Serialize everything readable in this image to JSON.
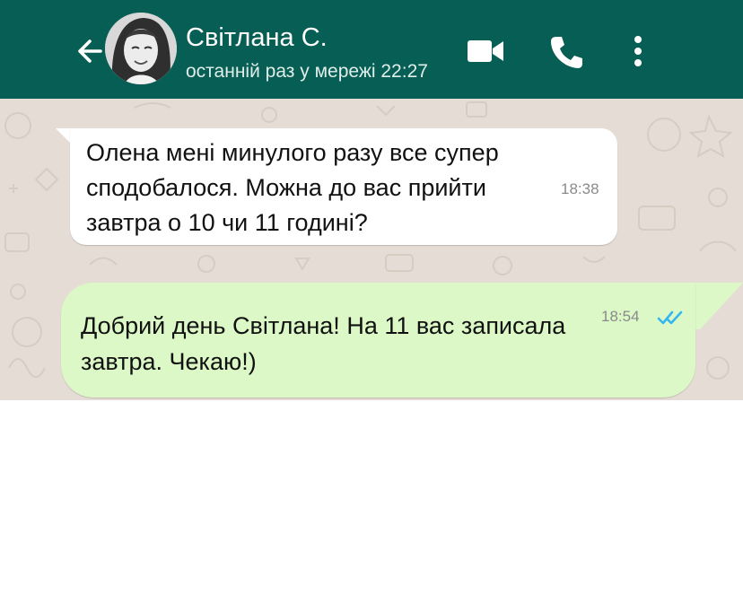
{
  "header": {
    "contact_name": "Світлана С.",
    "last_seen": "останній раз у мережі 22:27",
    "icons": [
      "back-arrow-icon",
      "video-call-icon",
      "phone-icon",
      "more-options-icon"
    ],
    "background_color": "#075E54"
  },
  "chat": {
    "background_color": "#E5DDD5",
    "messages": [
      {
        "direction": "incoming",
        "text": "Олена мені минулого разу все супер сподобалося. Можна до вас прийти завтра о 10 чи 11 годині?",
        "time": "18:38",
        "bubble_color": "#FFFFFF"
      },
      {
        "direction": "outgoing",
        "text": "Добрий день Світлана! На 11 вас записала завтра. Чекаю!)",
        "time": "18:54",
        "status": "read",
        "status_icon": "double-check-icon",
        "bubble_color": "#DCF8C6",
        "status_color": "#34B7F1"
      }
    ]
  }
}
